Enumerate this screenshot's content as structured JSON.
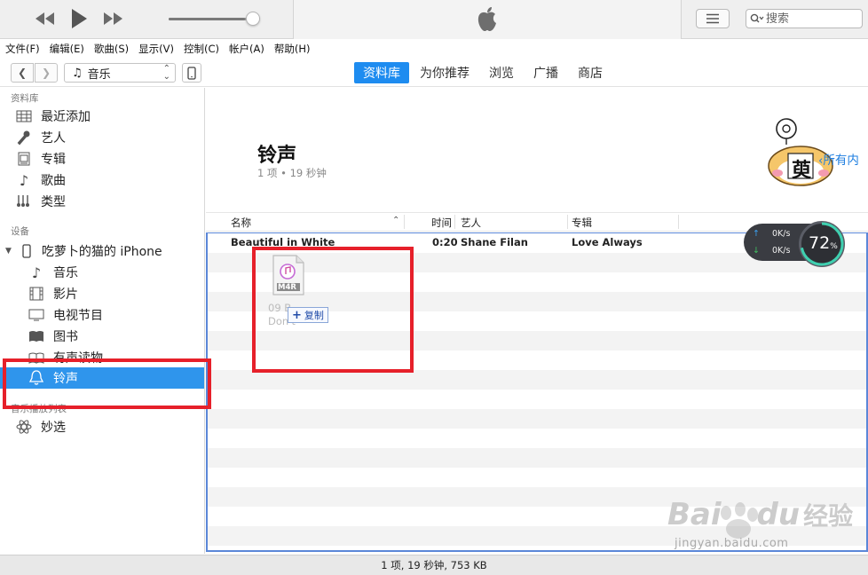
{
  "topbar": {
    "search_placeholder": "搜索",
    "volume_fraction": 0.9
  },
  "menu": [
    "文件(F)",
    "编辑(E)",
    "歌曲(S)",
    "显示(V)",
    "控制(C)",
    "帐户(A)",
    "帮助(H)"
  ],
  "nav": {
    "media_type": "音乐",
    "tabs": [
      {
        "label": "资料库",
        "active": true
      },
      {
        "label": "为你推荐",
        "active": false
      },
      {
        "label": "浏览",
        "active": false
      },
      {
        "label": "广播",
        "active": false
      },
      {
        "label": "商店",
        "active": false
      }
    ]
  },
  "sidebar": {
    "library_title": "资料库",
    "library_items": [
      {
        "label": "最近添加",
        "icon": "grid-icon"
      },
      {
        "label": "艺人",
        "icon": "microphone-icon"
      },
      {
        "label": "专辑",
        "icon": "album-icon"
      },
      {
        "label": "歌曲",
        "icon": "music-note-icon"
      },
      {
        "label": "类型",
        "icon": "genre-icon"
      }
    ],
    "devices_title": "设备",
    "device_name": "吃萝卜的猫的 iPhone",
    "device_items": [
      {
        "label": "音乐",
        "icon": "music-note-icon"
      },
      {
        "label": "影片",
        "icon": "film-icon"
      },
      {
        "label": "电视节目",
        "icon": "tv-icon"
      },
      {
        "label": "图书",
        "icon": "book-icon"
      },
      {
        "label": "有声读物",
        "icon": "audiobook-icon"
      },
      {
        "label": "铃声",
        "icon": "bell-icon",
        "selected": true
      }
    ],
    "playlists_title": "音乐播放列表",
    "playlist_items": [
      {
        "label": "妙选",
        "icon": "atom-icon"
      }
    ]
  },
  "content": {
    "title": "铃声",
    "subtitle": "1 项 • 19 秒钟",
    "all_link": "所有内",
    "sticker_char": "萸",
    "columns": {
      "name": "名称",
      "time": "时间",
      "artist": "艺人",
      "album": "专辑"
    },
    "rows": [
      {
        "name": "Beautiful in White",
        "time": "0:20",
        "artist": "Shane Filan",
        "album": "Love Always"
      }
    ]
  },
  "drag": {
    "file_type": "M4R",
    "ghost_line1": "09 B",
    "ghost_line2": "Don't",
    "copy_label": "复制"
  },
  "network": {
    "up": "0K/s",
    "down": "0K/s",
    "percent": "72",
    "percent_unit": "%"
  },
  "status": {
    "text": "1 项, 19 秒钟, 753 KB"
  },
  "watermark": {
    "brand_a": "Bai",
    "brand_b": "du",
    "brand_cn": "经验",
    "url": "jingyan.baidu.com"
  },
  "colors": {
    "accent": "#1e8cf0",
    "selection": "#2f95ec",
    "annotation": "#e6202a"
  }
}
